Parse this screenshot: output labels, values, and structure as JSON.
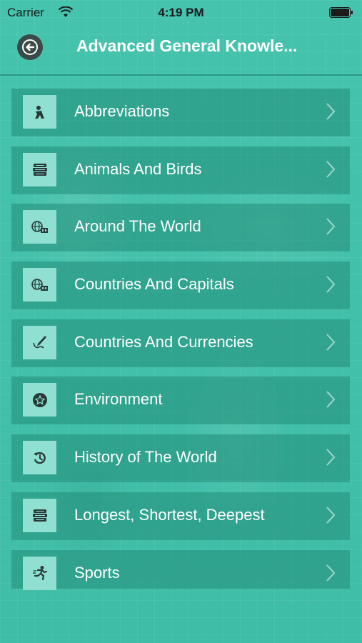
{
  "status": {
    "carrier": "Carrier",
    "time": "4:19 PM"
  },
  "nav": {
    "title": "Advanced General Knowle..."
  },
  "items": [
    {
      "label": "Abbreviations",
      "icon": "person-icon"
    },
    {
      "label": "Animals And Birds",
      "icon": "books-icon"
    },
    {
      "label": "Around The World",
      "icon": "globe-icon"
    },
    {
      "label": "Countries And Capitals",
      "icon": "globe-icon"
    },
    {
      "label": "Countries And Currencies",
      "icon": "pen-icon"
    },
    {
      "label": "Environment",
      "icon": "star-icon"
    },
    {
      "label": "History of The World",
      "icon": "history-icon"
    },
    {
      "label": "Longest, Shortest, Deepest",
      "icon": "books-icon"
    },
    {
      "label": "Sports",
      "icon": "runner-icon"
    }
  ],
  "colors": {
    "background": "#41bfa8",
    "row": "#2a8f7c",
    "icon_box": "#8fe0d1",
    "back_button": "#3a4a47"
  }
}
